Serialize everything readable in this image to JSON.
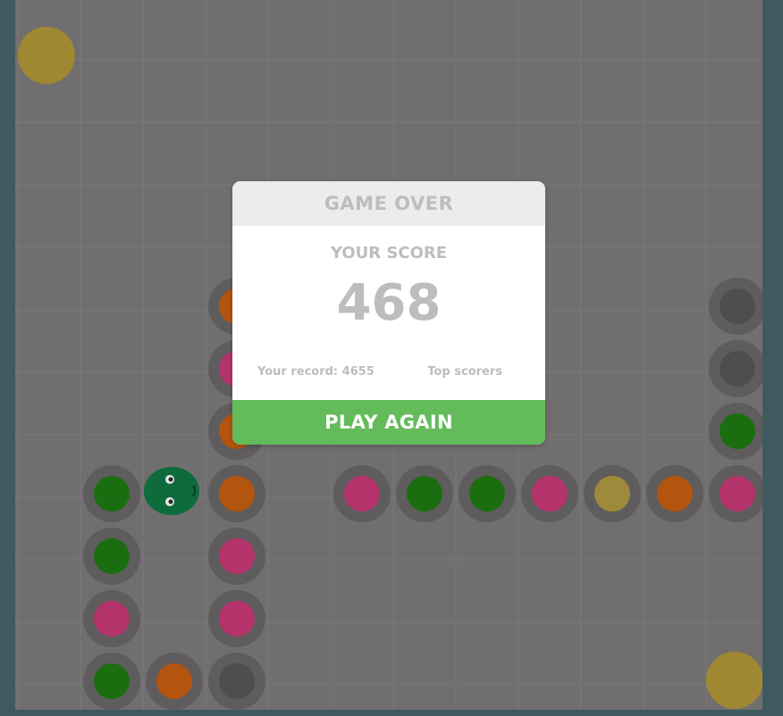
{
  "colors": {
    "background": "#3f5a5e",
    "board": "#716e6f",
    "grid_line": "#7b7879",
    "ring": "#5f5c5d",
    "green": "#1a6e0f",
    "pink": "#b4336a",
    "orange": "#b3540f",
    "yellow_piece": "#9f8a3b",
    "gray_piece": "#4f4d4e",
    "food_yellow": "#a08832",
    "snake_head": "#0e6b3c",
    "modal_header_bg": "#ececec",
    "modal_text": "#bdbdbd",
    "play_button": "#63bb5a"
  },
  "modal": {
    "title": "GAME OVER",
    "score_label": "YOUR SCORE",
    "score": "468",
    "record_label": "Your record:",
    "record_value": "4655",
    "top_scorers": "Top scorers",
    "play_again": "PLAY AGAIN"
  },
  "board": {
    "columns": 12,
    "rows": 11,
    "food": [
      {
        "col": 0,
        "row": 0,
        "color": "food_yellow"
      },
      {
        "col": 11,
        "row": 10,
        "color": "food_yellow"
      }
    ],
    "snake_head": {
      "col": 2,
      "row": 7
    },
    "pieces": [
      {
        "col": 3,
        "row": 4,
        "color": "orange"
      },
      {
        "col": 3,
        "row": 5,
        "color": "pink"
      },
      {
        "col": 3,
        "row": 6,
        "color": "orange"
      },
      {
        "col": 1,
        "row": 7,
        "color": "green"
      },
      {
        "col": 3,
        "row": 7,
        "color": "orange"
      },
      {
        "col": 5,
        "row": 7,
        "color": "pink"
      },
      {
        "col": 6,
        "row": 7,
        "color": "green"
      },
      {
        "col": 7,
        "row": 7,
        "color": "green"
      },
      {
        "col": 8,
        "row": 7,
        "color": "pink"
      },
      {
        "col": 9,
        "row": 7,
        "color": "yellow_piece"
      },
      {
        "col": 10,
        "row": 7,
        "color": "orange"
      },
      {
        "col": 11,
        "row": 7,
        "color": "pink"
      },
      {
        "col": 11,
        "row": 4,
        "color": "gray_piece"
      },
      {
        "col": 11,
        "row": 5,
        "color": "gray_piece"
      },
      {
        "col": 11,
        "row": 6,
        "color": "green"
      },
      {
        "col": 1,
        "row": 8,
        "color": "green"
      },
      {
        "col": 3,
        "row": 8,
        "color": "pink"
      },
      {
        "col": 1,
        "row": 9,
        "color": "pink"
      },
      {
        "col": 3,
        "row": 9,
        "color": "pink"
      },
      {
        "col": 1,
        "row": 10,
        "color": "green"
      },
      {
        "col": 2,
        "row": 10,
        "color": "orange"
      },
      {
        "col": 3,
        "row": 10,
        "color": "gray_piece"
      }
    ]
  }
}
